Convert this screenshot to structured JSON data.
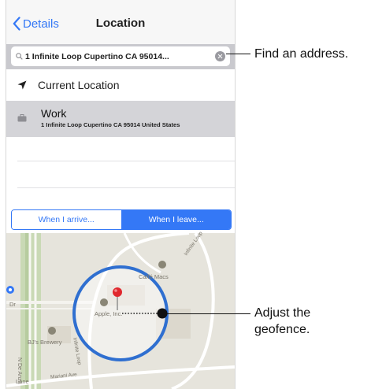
{
  "nav": {
    "back_label": "Details",
    "title": "Location"
  },
  "search": {
    "value": "1 Infinite Loop Cupertino CA 95014..."
  },
  "current_location": {
    "label": "Current Location"
  },
  "work": {
    "title": "Work",
    "address": "1 Infinite Loop Cupertino CA 95014 United States"
  },
  "segments": {
    "arrive": "When I arrive...",
    "leave": "When I leave...",
    "selected": "leave"
  },
  "map": {
    "labels": {
      "caffe": "Caffé Macs",
      "apple": "Apple, Inc.",
      "brewery": "BJ's Brewery",
      "infinite": "Infinite Loop",
      "mariani": "Mariani Ave",
      "loop": "Infinite Loop",
      "dr": "Dr",
      "de_anza": "N De Anza",
      "lane": "Lane"
    }
  },
  "callouts": {
    "find_address": "Find an address.",
    "adjust_1": "Adjust the",
    "adjust_2": "geofence."
  },
  "colors": {
    "accent": "#3478f6",
    "pin": "#e0282e",
    "map_bg": "#e6e4dc"
  }
}
